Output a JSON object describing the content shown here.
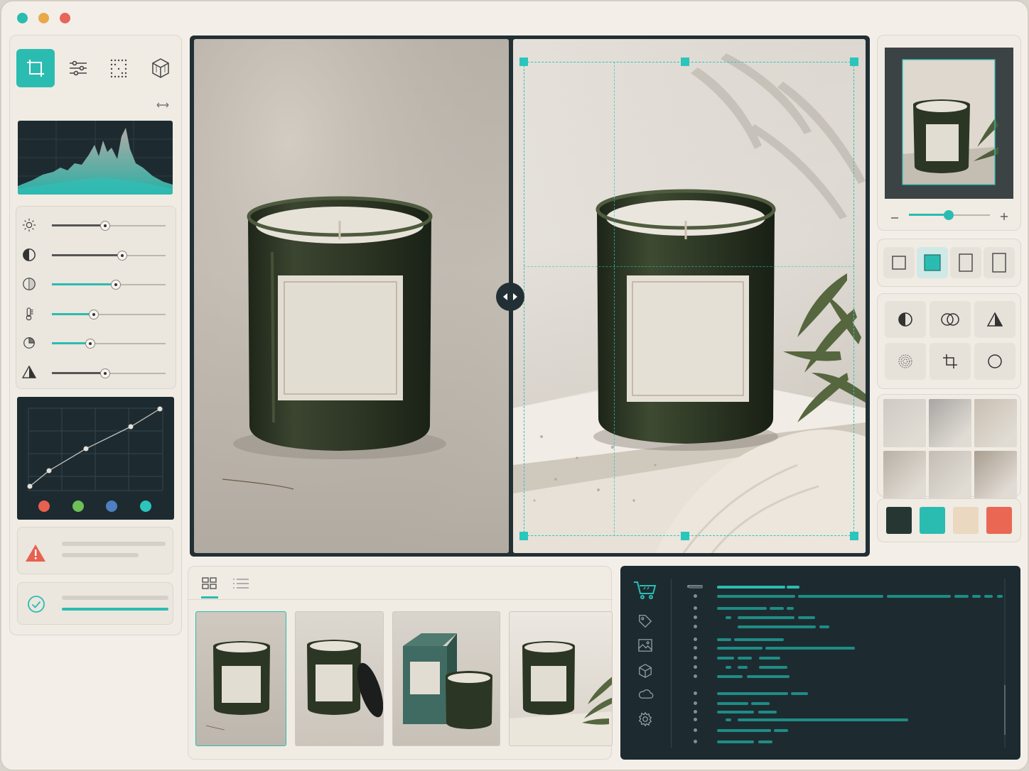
{
  "window": {
    "traffic_lights": [
      "#2bbcb1",
      "#e8a94a",
      "#e8655a"
    ]
  },
  "colors": {
    "accent": "#2bbcb1",
    "dark_panel": "#1d2b31",
    "background": "#f3efe8"
  },
  "tools": [
    {
      "name": "crop-tool",
      "icon": "crop-icon",
      "active": true
    },
    {
      "name": "adjust-tool",
      "icon": "sliders-icon",
      "active": false
    },
    {
      "name": "grid-tool",
      "icon": "dot-grid-icon",
      "active": false
    },
    {
      "name": "3d-tool",
      "icon": "cube-icon",
      "active": false
    }
  ],
  "adjustments": [
    {
      "name": "brightness",
      "icon": "sun-icon",
      "value": 0.47
    },
    {
      "name": "contrast",
      "icon": "contrast-icon",
      "value": 0.62
    },
    {
      "name": "saturation",
      "icon": "saturation-icon",
      "value": 0.56
    },
    {
      "name": "temperature",
      "icon": "thermometer-icon",
      "value": 0.37
    },
    {
      "name": "tint",
      "icon": "tint-icon",
      "value": 0.34
    },
    {
      "name": "sharpness",
      "icon": "triangle-icon",
      "value": 0.47
    }
  ],
  "curve_channels": [
    "#e8604f",
    "#6fbf57",
    "#4f7fc2",
    "#2bc5bb"
  ],
  "zoom": {
    "value": 0.49
  },
  "aspect_presets": [
    {
      "name": "aspect-square",
      "active": false
    },
    {
      "name": "aspect-1-1-filled",
      "active": true
    },
    {
      "name": "aspect-portrait",
      "active": false
    },
    {
      "name": "aspect-tall",
      "active": false
    }
  ],
  "effects": [
    "contrast-icon",
    "blend-icon",
    "triangle-icon",
    "dots-circle-icon",
    "crop-icon",
    "circle-icon"
  ],
  "textures": [
    "#cfcac3",
    "#a7a6a3",
    "#c9bfb2",
    "#b8b0a5",
    "#c3bdb5",
    "#a89d90"
  ],
  "swatches": [
    "#263733",
    "#2bbcb1",
    "#ead9c0",
    "#ea6753"
  ],
  "view_toggles": [
    "grid-view-icon",
    "list-view-icon"
  ],
  "nav_icons": [
    "cart-icon",
    "tag-icon",
    "image-icon",
    "box-icon",
    "cloud-icon",
    "settings-icon"
  ]
}
